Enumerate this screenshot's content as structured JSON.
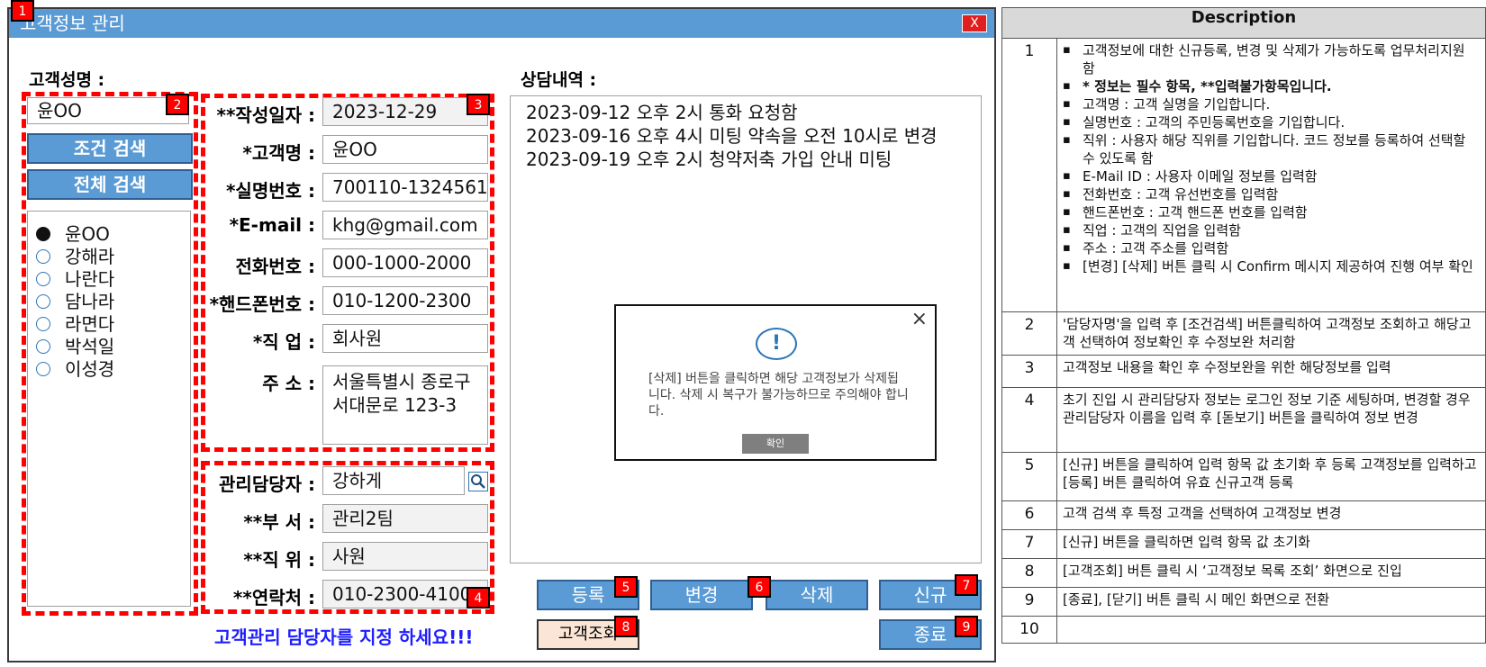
{
  "window": {
    "title": "고객정보 관리",
    "close_label": "X"
  },
  "badges": [
    "1",
    "2",
    "3",
    "4",
    "5",
    "6",
    "7",
    "8",
    "9"
  ],
  "search": {
    "label": "고객성명 :",
    "value": "윤OO",
    "cond_button": "조건 검색",
    "all_button": "전체 검색",
    "results": [
      {
        "name": "윤OO",
        "selected": true
      },
      {
        "name": "강해라",
        "selected": false
      },
      {
        "name": "나란다",
        "selected": false
      },
      {
        "name": "담나라",
        "selected": false
      },
      {
        "name": "라면다",
        "selected": false
      },
      {
        "name": "박석일",
        "selected": false
      },
      {
        "name": "이성경",
        "selected": false
      }
    ]
  },
  "customer": {
    "fields": [
      {
        "label": "**작성일자 :",
        "value": "2023-12-29"
      },
      {
        "label": "*고객명 :",
        "value": "윤OO"
      },
      {
        "label": "*실명번호 :",
        "value": "700110-1324561"
      },
      {
        "label": "*E-mail :",
        "value": "khg@gmail.com"
      },
      {
        "label": "전화번호 :",
        "value": "000-1000-2000"
      },
      {
        "label": "*핸드폰번호 :",
        "value": "010-1200-2300"
      },
      {
        "label": "*직  업 :",
        "value": "회사원"
      }
    ],
    "address_label": "주  소 :",
    "address_value": "서울특별시 종로구 서대문로 123-3"
  },
  "manager": {
    "fields": [
      {
        "label": "관리담당자 :",
        "value": "강하게"
      },
      {
        "label": "**부  서 :",
        "value": "관리2팀"
      },
      {
        "label": "**직  위 :",
        "value": "사원"
      },
      {
        "label": "**연락처 :",
        "value": "010-2300-4100"
      }
    ],
    "warning": "고객관리 담당자를 지정 하세요!!!"
  },
  "consult": {
    "label": "상담내역 :",
    "lines": [
      "2023-09-12 오후 2시 통화 요청함",
      "2023-09-16 오후 4시 미팅 약속을 오전 10시로 변경",
      "2023-09-19 오후 2시 청약저축 가입 안내 미팅"
    ]
  },
  "dialog": {
    "icon": "!",
    "close": "×",
    "message": "[삭제] 버튼을 클릭하면 해당 고객정보가 삭제됩니다. 삭제 시 복구가 불가능하므로 주의해야 합니다.",
    "ok": "확인"
  },
  "buttons": {
    "register": "등록",
    "change": "변경",
    "delete": "삭제",
    "new": "신규",
    "lookup": "고객조회",
    "exit": "종료"
  },
  "description": {
    "header": "Description",
    "rows": [
      {
        "n": "1",
        "items": [
          "고객정보에 대한 신규등록, 변경 및 삭제가 가능하도록 업무처리지원 함",
          "* 정보는 필수 항목, **입력불가항목입니다.",
          "고객명 : 고객 실명을 기입합니다.",
          "실명번호 : 고객의 주민등록번호을 기입합니다.",
          "직위 : 사용자 해당 직위를 기입합니다. 코드 정보를 등록하여 선택할 수 있도록 함",
          "E-Mail ID : 사용자 이메일 정보를 입력함",
          "전화번호 : 고객 유선번호를 입력함",
          "핸드폰번호 : 고객 핸드폰 번호를 입력함",
          "직업 : 고객의 직업을 입력함",
          "주소 : 고객 주소를 입력함",
          "[변경] [삭제] 버튼 클릭 시 Confirm 메시지 제공하여 진행 여부 확인"
        ]
      },
      {
        "n": "2",
        "text": "'담당자명'을 입력 후 [조건검색] 버튼클릭하여 고객정보 조회하고 해당고객 선택하여 정보확인 후 수정보완 처리함"
      },
      {
        "n": "3",
        "text": "고객정보 내용을 확인 후 수정보완을 위한 해당정보를 입력"
      },
      {
        "n": "4",
        "text": "초기 진입 시 관리담당자 정보는 로그인 정보 기준 세팅하며, 변경할 경우 관리담당자 이름을 입력 후 [돋보기] 버튼을 클릭하여 정보 변경"
      },
      {
        "n": "5",
        "text": "[신규] 버튼을 클릭하여 입력 항목 값 초기화 후 등록 고객정보를 입력하고 [등록] 버튼 클릭하여 유효 신규고객 등록"
      },
      {
        "n": "6",
        "text": "고객 검색 후 특정 고객을 선택하여 고객정보 변경"
      },
      {
        "n": "7",
        "text": "[신규] 버튼을 클릭하면 입력 항목 값 초기화"
      },
      {
        "n": "8",
        "text": "[고객조회] 버튼 클릭 시 ‘고객정보 목록 조회’ 화면으로 진입"
      },
      {
        "n": "9",
        "text": "[종료], [닫기] 버튼 클릭 시 메인 화면으로 전환"
      },
      {
        "n": "10",
        "text": ""
      }
    ]
  }
}
